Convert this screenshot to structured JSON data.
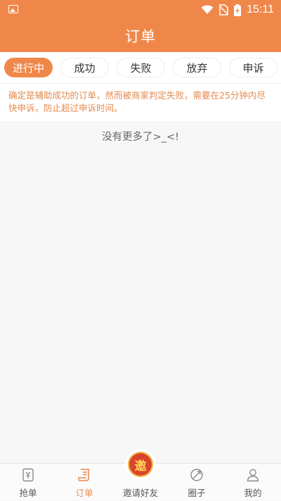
{
  "status_bar": {
    "time": "15:11"
  },
  "header": {
    "title": "订单"
  },
  "tabs": [
    {
      "label": "进行中"
    },
    {
      "label": "成功"
    },
    {
      "label": "失败"
    },
    {
      "label": "放弃"
    },
    {
      "label": "申诉"
    }
  ],
  "notice": {
    "text": "确定是辅助成功的订单，然而被商家判定失败，需要在25分钟内尽快申诉，防止超过申诉时间。"
  },
  "empty_message": "没有更多了>_<!",
  "bottom_nav": {
    "items": [
      {
        "label": "抢单",
        "icon": "grab-order-icon"
      },
      {
        "label": "订单",
        "icon": "order-icon"
      },
      {
        "label": "邀请好友",
        "icon": "invite-badge-icon",
        "badge_text": "邀"
      },
      {
        "label": "圈子",
        "icon": "circle-icon"
      },
      {
        "label": "我的",
        "icon": "profile-icon"
      }
    ]
  },
  "colors": {
    "accent": "#f0874a",
    "notice_text": "#e38a4f"
  }
}
